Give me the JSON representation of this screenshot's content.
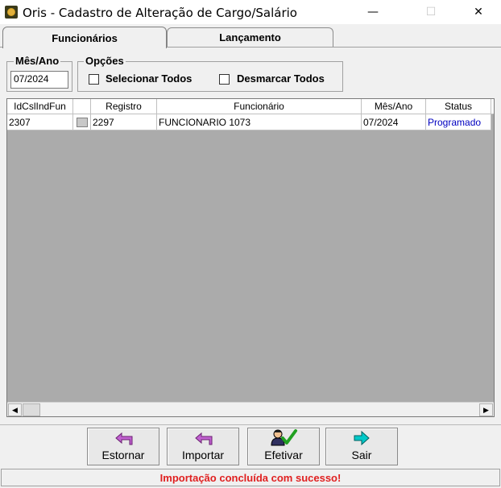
{
  "window": {
    "title": "Oris - Cadastro de Alteração de Cargo/Salário",
    "minimize_glyph": "—",
    "maximize_glyph": "☐",
    "close_glyph": "✕"
  },
  "tabs": [
    {
      "label": "Funcionários",
      "active": true
    },
    {
      "label": "Lançamento",
      "active": false
    }
  ],
  "filters": {
    "month_year_label": "Mês/Ano",
    "month_year_value": "07/2024",
    "options_label": "Opções",
    "select_all_label": "Selecionar Todos",
    "deselect_all_label": "Desmarcar Todos"
  },
  "grid": {
    "columns": [
      "IdCslIndFun",
      "",
      "Registro",
      "Funcionário",
      "Mês/Ano",
      "Status"
    ],
    "rows": [
      {
        "id": "2307",
        "registro": "2297",
        "funcionario": "FUNCIONARIO 1073",
        "mes_ano": "07/2024",
        "status": "Programado"
      }
    ],
    "scroll_left": "◀",
    "scroll_right": "▶"
  },
  "buttons": {
    "estornar": "Estornar",
    "importar": "Importar",
    "efetivar": "Efetivar",
    "sair": "Sair"
  },
  "status_message": "Importação concluída com sucesso!",
  "colors": {
    "status_text": "#0000c0",
    "message_text": "#e02020",
    "arrow_purple": "#c060d0",
    "arrow_cyan": "#00c8c8",
    "check_green": "#20a020"
  }
}
